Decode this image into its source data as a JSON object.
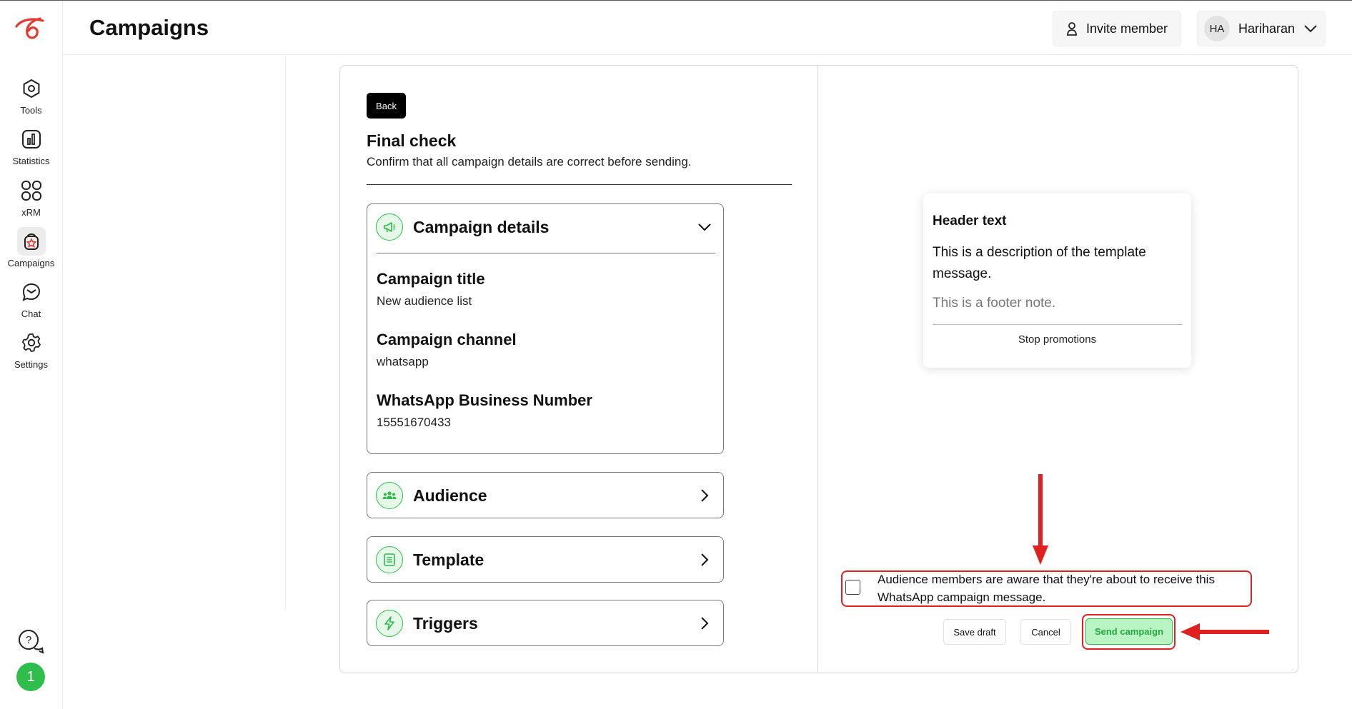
{
  "app": {
    "page_title": "Campaigns",
    "brand_color": "#e53935",
    "accent_color": "#2fbd4c"
  },
  "sidebar": {
    "items": [
      {
        "label": "Tools",
        "icon": "hexagon-icon"
      },
      {
        "label": "Statistics",
        "icon": "bar-chart-icon"
      },
      {
        "label": "xRM",
        "icon": "grid-icon"
      },
      {
        "label": "Campaigns",
        "icon": "campaign-icon",
        "active": true
      },
      {
        "label": "Chat",
        "icon": "chat-icon"
      },
      {
        "label": "Settings",
        "icon": "gear-icon"
      }
    ],
    "notification_count": "1"
  },
  "header": {
    "invite_label": "Invite member",
    "user_initials": "HA",
    "user_name": "Hariharan"
  },
  "final_check": {
    "back_label": "Back",
    "title": "Final check",
    "subtitle": "Confirm that all campaign details are correct before sending.",
    "sections": [
      {
        "title": "Campaign details",
        "expanded": true,
        "fields": [
          {
            "label": "Campaign title",
            "value": "New audience list"
          },
          {
            "label": "Campaign channel",
            "value": "whatsapp"
          },
          {
            "label": "WhatsApp Business Number",
            "value": "15551670433"
          }
        ]
      },
      {
        "title": "Audience",
        "expanded": false
      },
      {
        "title": "Template",
        "expanded": false
      },
      {
        "title": "Triggers",
        "expanded": false
      }
    ]
  },
  "preview": {
    "header_text": "Header text",
    "description": "This is a description of the template message.",
    "footer": "This is a footer note.",
    "button": "Stop promotions"
  },
  "actions": {
    "consent_text": "Audience members are aware that they're about to receive this WhatsApp campaign message.",
    "consent_checked": false,
    "save_draft_label": "Save draft",
    "cancel_label": "Cancel",
    "send_label": "Send campaign"
  }
}
